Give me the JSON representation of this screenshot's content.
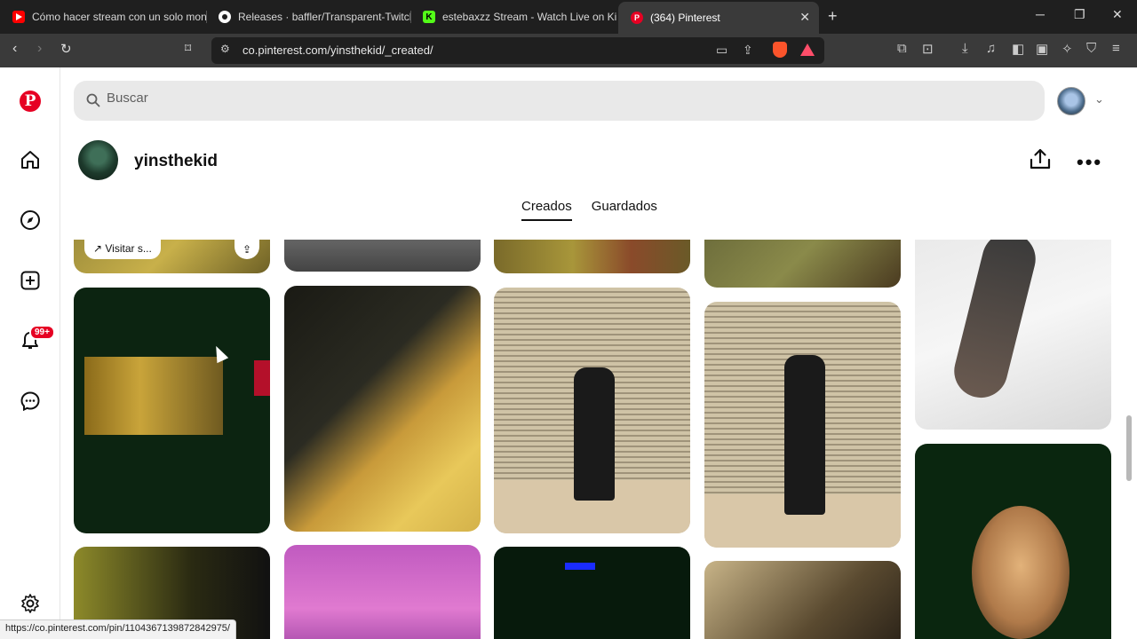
{
  "browser": {
    "tabs": [
      {
        "title": "Cómo hacer stream con un solo mon",
        "icon": "youtube-icon",
        "color": "#ff0000"
      },
      {
        "title": "Releases · baffler/Transparent-Twitch-",
        "icon": "github-icon",
        "color": "#ffffff"
      },
      {
        "title": "estebaxzz Stream - Watch Live on Kic",
        "icon": "kick-icon",
        "color": "#53fc18"
      },
      {
        "title": "(364) Pinterest",
        "icon": "pinterest-icon",
        "color": "#e60023"
      }
    ],
    "url": "co.pinterest.com/yinsthekid/_created/",
    "status_url": "https://co.pinterest.com/pin/1104367139872842975/"
  },
  "search": {
    "placeholder": "Buscar"
  },
  "sidebar": {
    "notification_badge": "99+"
  },
  "profile": {
    "username": "yinsthekid"
  },
  "profile_tabs": {
    "created": "Creados",
    "saved": "Guardados"
  },
  "pins": {
    "visit_label": "Visitar s..."
  },
  "colors": {
    "brand": "#e60023",
    "text": "#111111",
    "search_bg": "#e9e9e9"
  }
}
